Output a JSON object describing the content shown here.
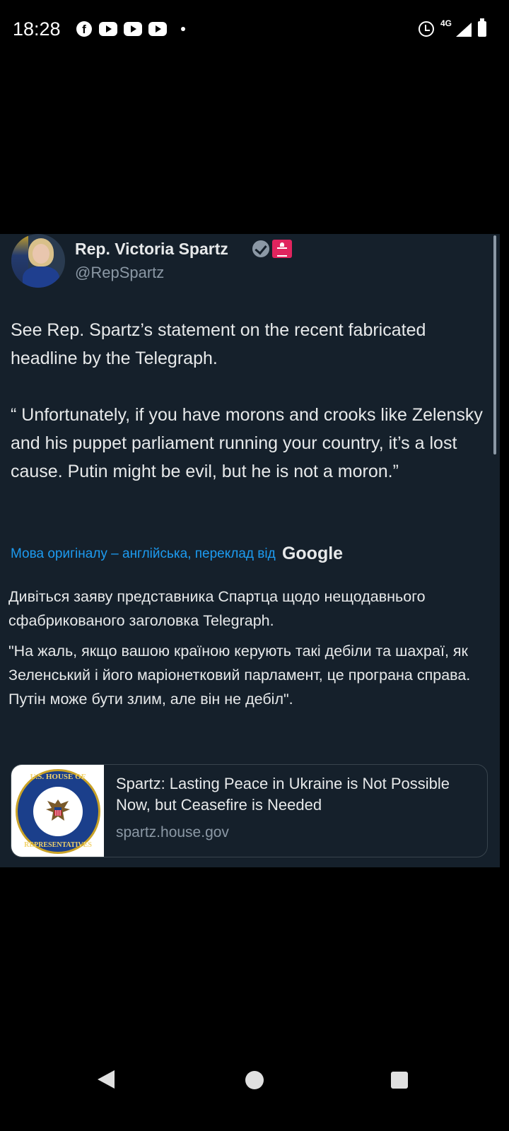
{
  "status_bar": {
    "time": "18:28",
    "network": "4G",
    "icons": [
      "facebook-icon",
      "youtube-icon",
      "youtube-icon",
      "youtube-icon",
      "notification-dot-icon",
      "alarm-icon",
      "signal-icon",
      "battery-icon"
    ]
  },
  "tweet": {
    "author_name": "Rep. Victoria Spartz",
    "handle": "@RepSpartz",
    "badges": [
      "verified-icon",
      "capitol-icon"
    ],
    "text_p1": "See Rep. Spartz’s statement on the recent fabricated headline by the Telegraph.",
    "text_p2": "“ Unfortunately, if you have morons and crooks like Zelensky and his puppet parliament running your country, it’s a lost cause. Putin might be evil, but he is not a moron.”",
    "translation_note": "Мова оригіналу – англійська, переклад від",
    "translation_provider": "Google",
    "translated_p1": "Дивіться заяву представника Спартца щодо нещодавнього сфабрикованого заголовка Telegraph.",
    "translated_p2": "\"На жаль, якщо вашою країною керують такі дебіли та шахраї, як Зеленський і його маріонетковий парламент, це програна справа. Путін може бути злим, але він не дебіл\"."
  },
  "link_card": {
    "title": "Spartz: Lasting Peace in Ukraine is Not Possible Now, but Ceasefire is Needed",
    "domain": "spartz.house.gov",
    "seal_text_top": "U.S. HOUSE OF",
    "seal_text_bottom": "REPRESENTATIVES"
  },
  "navigation": [
    "back-icon",
    "home-icon",
    "recents-icon"
  ],
  "colors": {
    "card_background": "#15202b",
    "link_blue": "#1d9bf0",
    "secondary_text": "#8b98a5",
    "primary_text": "#e7e9ea"
  }
}
